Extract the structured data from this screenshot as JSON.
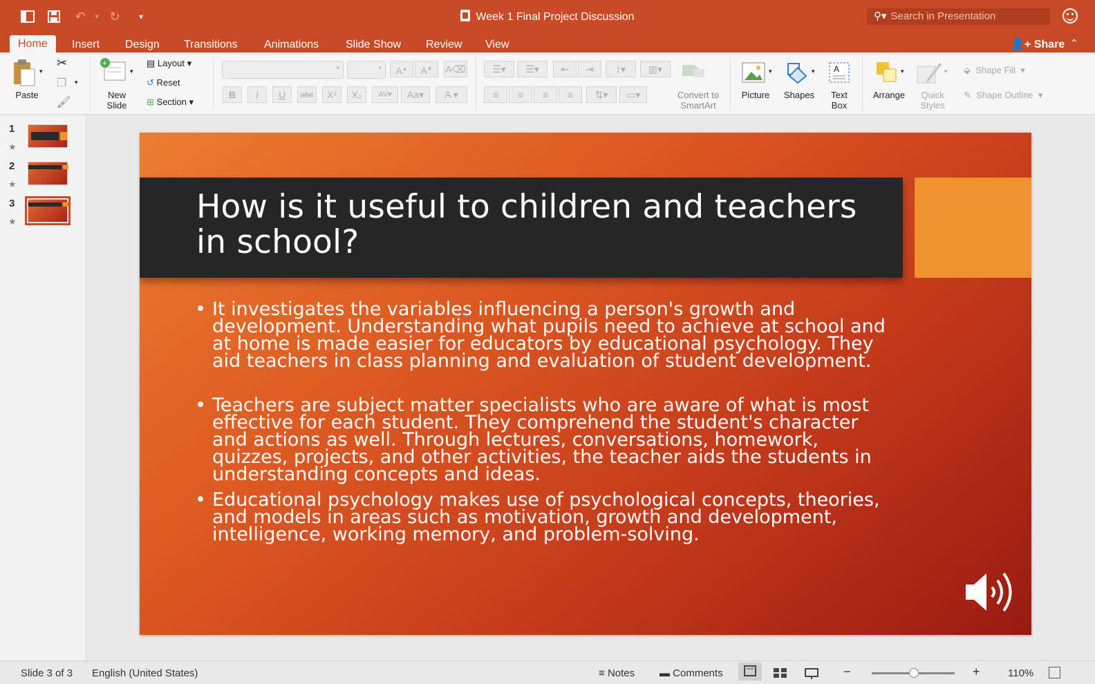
{
  "window": {
    "title": "Week 1 Final Project Discussion",
    "search_placeholder": "Search in Presentation"
  },
  "tabs": [
    "Home",
    "Insert",
    "Design",
    "Transitions",
    "Animations",
    "Slide Show",
    "Review",
    "View"
  ],
  "share_label": "Share",
  "ribbon": {
    "paste": "Paste",
    "new_slide_line1": "New",
    "new_slide_line2": "Slide",
    "layout": "Layout",
    "reset": "Reset",
    "section": "Section",
    "convert_line1": "Convert to",
    "convert_line2": "SmartArt",
    "picture": "Picture",
    "shapes": "Shapes",
    "textbox_line1": "Text",
    "textbox_line2": "Box",
    "arrange": "Arrange",
    "quick_line1": "Quick",
    "quick_line2": "Styles",
    "shape_fill": "Shape Fill",
    "shape_outline": "Shape Outline"
  },
  "thumbnails": [
    {
      "number": "1"
    },
    {
      "number": "2"
    },
    {
      "number": "3"
    }
  ],
  "slide": {
    "title": "How is it useful to children and teachers in school?",
    "bullets": [
      "It investigates the variables influencing a person's growth and development. Understanding what pupils need to achieve at school and at home is made easier for educators by educational psychology. They aid teachers in class planning and evaluation of student development.",
      "Teachers are subject matter specialists who are aware of what is most effective for each student. They comprehend the student's character and actions as well. Through lectures, conversations, homework, quizzes, projects, and other activities, the teacher aids the students in understanding concepts and ideas.",
      "Educational psychology makes use of psychological concepts, theories, and models in areas such as motivation, growth and development, intelligence, working memory, and problem-solving."
    ]
  },
  "status": {
    "slide_counter": "Slide 3 of 3",
    "language": "English (United States)",
    "notes": "Notes",
    "comments": "Comments",
    "zoom": "110%",
    "zoom_minus": "−",
    "zoom_plus": "+"
  },
  "colors": {
    "accent": "#c94a26",
    "title_band": "#262626",
    "slide_accent": "#ef9230"
  }
}
